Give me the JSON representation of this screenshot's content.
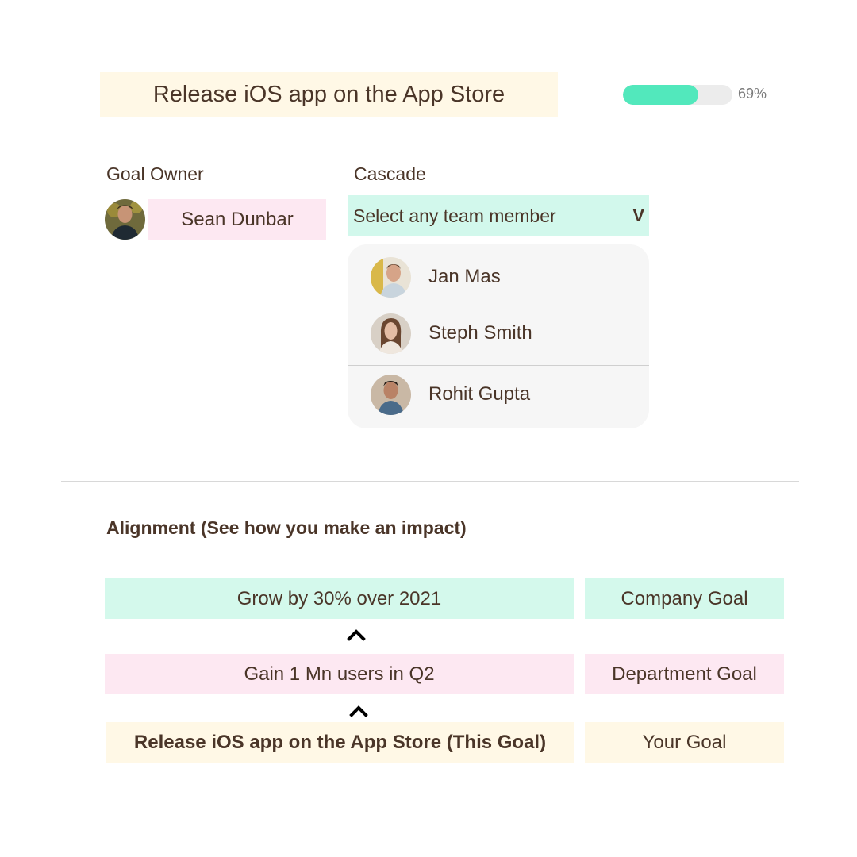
{
  "goal": {
    "title": "Release iOS app on the App Store",
    "progress_label": "69%",
    "progress_fraction": 0.69
  },
  "owner": {
    "label": "Goal Owner",
    "name": "Sean Dunbar"
  },
  "cascade": {
    "label": "Cascade",
    "placeholder": "Select any team member",
    "chevron": "V",
    "members": [
      {
        "name": "Jan Mas"
      },
      {
        "name": "Steph Smith"
      },
      {
        "name": "Rohit Gupta"
      }
    ]
  },
  "alignment": {
    "title": "Alignment (See how you make an impact)",
    "rows": [
      {
        "goal": "Grow by 30% over 2021",
        "level": "Company Goal"
      },
      {
        "goal": "Gain 1 Mn users in Q2",
        "level": "Department Goal"
      },
      {
        "goal": "Release iOS app on the App Store (This Goal)",
        "level": "Your Goal"
      }
    ]
  },
  "colors": {
    "text": "#4a3528",
    "progress": "#52e8bc",
    "mint": "#d4f9ec",
    "pink": "#fde8f2",
    "cream": "#fff8e6"
  }
}
